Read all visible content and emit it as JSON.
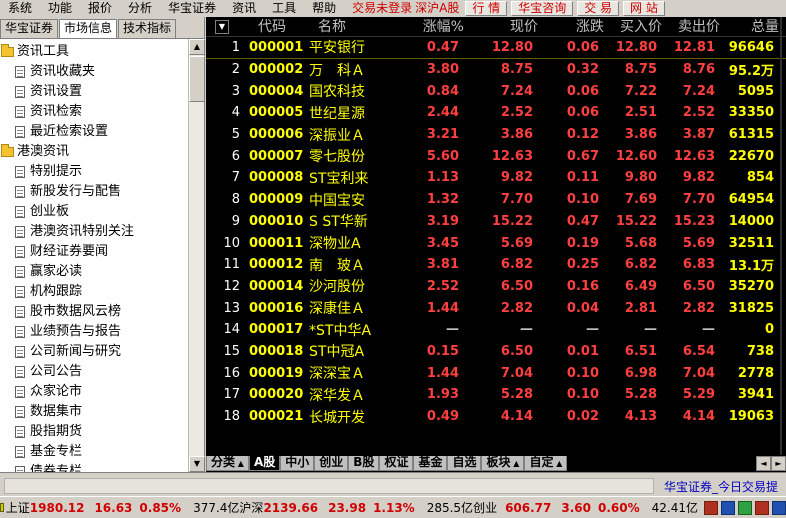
{
  "menu": {
    "items": [
      "系统",
      "功能",
      "报价",
      "分析",
      "华宝证券",
      "资讯",
      "工具",
      "帮助"
    ],
    "login_status": "交易未登录",
    "market": "深沪A股",
    "btn_quote": "行 情",
    "btn_advisor": "华宝咨询",
    "btn_trade": "交 易",
    "btn_web": "网 站"
  },
  "left_tabs": [
    "华宝证券",
    "市场信息",
    "技术指标"
  ],
  "tree": [
    {
      "type": "folder",
      "label": "资讯工具"
    },
    {
      "type": "leaf",
      "label": "资讯收藏夹"
    },
    {
      "type": "leaf",
      "label": "资讯设置"
    },
    {
      "type": "leaf",
      "label": "资讯检索"
    },
    {
      "type": "leaf",
      "label": "最近检索设置"
    },
    {
      "type": "folder",
      "label": "港澳资讯"
    },
    {
      "type": "leaf",
      "label": "特别提示"
    },
    {
      "type": "leaf",
      "label": "新股发行与配售"
    },
    {
      "type": "leaf",
      "label": "创业板"
    },
    {
      "type": "leaf",
      "label": "港澳资讯特别关注"
    },
    {
      "type": "leaf",
      "label": "财经证券要闻"
    },
    {
      "type": "leaf",
      "label": "赢家必读"
    },
    {
      "type": "leaf",
      "label": "机构跟踪"
    },
    {
      "type": "leaf",
      "label": "股市数据风云榜"
    },
    {
      "type": "leaf",
      "label": "业绩预告与报告"
    },
    {
      "type": "leaf",
      "label": "公司新闻与研究"
    },
    {
      "type": "leaf",
      "label": "公司公告"
    },
    {
      "type": "leaf",
      "label": "众家论市"
    },
    {
      "type": "leaf",
      "label": "数据集市"
    },
    {
      "type": "leaf",
      "label": "股指期货"
    },
    {
      "type": "leaf",
      "label": "基金专栏"
    },
    {
      "type": "leaf",
      "label": "债券专栏"
    }
  ],
  "grid": {
    "headers": {
      "sort": "▼",
      "code": "代码",
      "name": "名称",
      "chg": "涨幅%",
      "price": "现价",
      "diff": "涨跌",
      "bid": "买入价",
      "ask": "卖出价",
      "vol": "总量"
    },
    "rows": [
      {
        "idx": "1",
        "code": "000001",
        "name": "平安银行",
        "chg": "0.47",
        "price": "12.80",
        "diff": "0.06",
        "bid": "12.80",
        "ask": "12.81",
        "vol": "96646"
      },
      {
        "idx": "2",
        "code": "000002",
        "name": "万　科Ａ",
        "chg": "3.80",
        "price": "8.75",
        "diff": "0.32",
        "bid": "8.75",
        "ask": "8.76",
        "vol": "95.2万"
      },
      {
        "idx": "3",
        "code": "000004",
        "name": "国农科技",
        "chg": "0.84",
        "price": "7.24",
        "diff": "0.06",
        "bid": "7.22",
        "ask": "7.24",
        "vol": "5095"
      },
      {
        "idx": "4",
        "code": "000005",
        "name": "世纪星源",
        "chg": "2.44",
        "price": "2.52",
        "diff": "0.06",
        "bid": "2.51",
        "ask": "2.52",
        "vol": "33350"
      },
      {
        "idx": "5",
        "code": "000006",
        "name": "深振业Ａ",
        "chg": "3.21",
        "price": "3.86",
        "diff": "0.12",
        "bid": "3.86",
        "ask": "3.87",
        "vol": "61315"
      },
      {
        "idx": "6",
        "code": "000007",
        "name": "零七股份",
        "chg": "5.60",
        "price": "12.63",
        "diff": "0.67",
        "bid": "12.60",
        "ask": "12.63",
        "vol": "22670"
      },
      {
        "idx": "7",
        "code": "000008",
        "name": "ST宝利来",
        "chg": "1.13",
        "price": "9.82",
        "diff": "0.11",
        "bid": "9.80",
        "ask": "9.82",
        "vol": "854"
      },
      {
        "idx": "8",
        "code": "000009",
        "name": "中国宝安",
        "chg": "1.32",
        "price": "7.70",
        "diff": "0.10",
        "bid": "7.69",
        "ask": "7.70",
        "vol": "64954"
      },
      {
        "idx": "9",
        "code": "000010",
        "name": "S ST华新",
        "chg": "3.19",
        "price": "15.22",
        "diff": "0.47",
        "bid": "15.22",
        "ask": "15.23",
        "vol": "14000"
      },
      {
        "idx": "10",
        "code": "000011",
        "name": "深物业A",
        "chg": "3.45",
        "price": "5.69",
        "diff": "0.19",
        "bid": "5.68",
        "ask": "5.69",
        "vol": "32511"
      },
      {
        "idx": "11",
        "code": "000012",
        "name": "南　玻Ａ",
        "chg": "3.81",
        "price": "6.82",
        "diff": "0.25",
        "bid": "6.82",
        "ask": "6.83",
        "vol": "13.1万"
      },
      {
        "idx": "12",
        "code": "000014",
        "name": "沙河股份",
        "chg": "2.52",
        "price": "6.50",
        "diff": "0.16",
        "bid": "6.49",
        "ask": "6.50",
        "vol": "35270"
      },
      {
        "idx": "13",
        "code": "000016",
        "name": "深康佳Ａ",
        "chg": "1.44",
        "price": "2.82",
        "diff": "0.04",
        "bid": "2.81",
        "ask": "2.82",
        "vol": "31825"
      },
      {
        "idx": "14",
        "code": "000017",
        "name": "*ST中华A",
        "chg": "—",
        "price": "—",
        "diff": "—",
        "bid": "—",
        "ask": "—",
        "vol": "0"
      },
      {
        "idx": "15",
        "code": "000018",
        "name": "ST中冠A",
        "chg": "0.15",
        "price": "6.50",
        "diff": "0.01",
        "bid": "6.51",
        "ask": "6.54",
        "vol": "738"
      },
      {
        "idx": "16",
        "code": "000019",
        "name": "深深宝Ａ",
        "chg": "1.44",
        "price": "7.04",
        "diff": "0.10",
        "bid": "6.98",
        "ask": "7.04",
        "vol": "2778"
      },
      {
        "idx": "17",
        "code": "000020",
        "name": "深华发Ａ",
        "chg": "1.93",
        "price": "5.28",
        "diff": "0.10",
        "bid": "5.28",
        "ask": "5.29",
        "vol": "3941"
      },
      {
        "idx": "18",
        "code": "000021",
        "name": "长城开发",
        "chg": "0.49",
        "price": "4.14",
        "diff": "0.02",
        "bid": "4.13",
        "ask": "4.14",
        "vol": "19063"
      }
    ]
  },
  "tabs": [
    "分类",
    "A股",
    "中小",
    "创业",
    "B股",
    "权证",
    "基金",
    "自选",
    "板块",
    "自定"
  ],
  "tabs_with_caret": [
    "分类",
    "板块",
    "自定"
  ],
  "active_tab": "A股",
  "infobar": {
    "link": "华宝证券_今日交易提"
  },
  "status": {
    "sh_label": "上证",
    "sh_index": "1980.12",
    "sh_change": "16.63",
    "sh_pct": "0.85%",
    "sh_amount": "377.4亿",
    "hs_label": "沪深",
    "hs_index": "2139.66",
    "hs_change": "23.98",
    "hs_pct": "1.13%",
    "hs_amount": "285.5亿",
    "cy_label": "创业",
    "cy_index": "606.77",
    "cy_change": "3.60",
    "cy_pct": "0.60%",
    "cy_amount": "42.41亿"
  }
}
